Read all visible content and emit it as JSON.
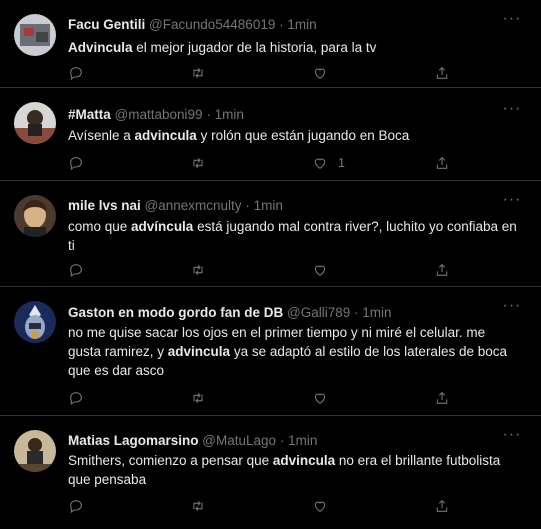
{
  "tweets": [
    {
      "name": "Facu Gentili",
      "handle": "@Facundo54486019",
      "separator": "·",
      "time": "1min",
      "text_parts": [
        {
          "bold": true,
          "text": "Advincula"
        },
        {
          "bold": false,
          "text": " el mejor jugador de la historia, para la tv"
        }
      ],
      "counts": {
        "reply": "",
        "retweet": "",
        "like": ""
      },
      "avatar_color": "#6a6f77"
    },
    {
      "name": "#Matta",
      "handle": "@mattaboni99",
      "separator": "·",
      "time": "1min",
      "text_parts": [
        {
          "bold": false,
          "text": "Avísenle a "
        },
        {
          "bold": true,
          "text": "advincula"
        },
        {
          "bold": false,
          "text": " y rolón que están jugando en Boca"
        }
      ],
      "counts": {
        "reply": "",
        "retweet": "",
        "like": "1"
      },
      "avatar_color": "#8a4a3a"
    },
    {
      "name": "mile lvs nai",
      "handle": "@annexmcnulty",
      "separator": "·",
      "time": "1min",
      "text_parts": [
        {
          "bold": false,
          "text": "como que "
        },
        {
          "bold": true,
          "text": "advíncula"
        },
        {
          "bold": false,
          "text": " está jugando mal contra river?, luchito yo confiaba en ti"
        }
      ],
      "counts": {
        "reply": "",
        "retweet": "",
        "like": ""
      },
      "avatar_color": "#7a5a40"
    },
    {
      "name": "Gaston en modo gordo fan de DB",
      "handle": "@Galli789",
      "separator": "·",
      "time": "1min",
      "text_parts": [
        {
          "bold": false,
          "text": "no me quise sacar los ojos en el primer tiempo y ni miré el celular. me gusta ramirez, y "
        },
        {
          "bold": true,
          "text": "advincula"
        },
        {
          "bold": false,
          "text": " ya se adaptó al estilo de los laterales de boca que es dar asco"
        }
      ],
      "counts": {
        "reply": "",
        "retweet": "",
        "like": ""
      },
      "avatar_color": "#3a4f9a"
    },
    {
      "name": "Matias Lagomarsino",
      "handle": "@MatuLago",
      "separator": "·",
      "time": "1min",
      "text_parts": [
        {
          "bold": false,
          "text": "Smithers, comienzo a pensar que "
        },
        {
          "bold": true,
          "text": "advincula"
        },
        {
          "bold": false,
          "text": " no era el brillante futbolista que pensaba"
        }
      ],
      "counts": {
        "reply": "",
        "retweet": "",
        "like": ""
      },
      "avatar_color": "#5a4630"
    }
  ],
  "icons": {
    "reply": "reply-icon",
    "retweet": "retweet-icon",
    "like": "like-icon",
    "share": "share-icon",
    "more": "more-icon"
  },
  "colors": {
    "background": "#000000",
    "text": "#e7e9ea",
    "secondary": "#71767b",
    "divider": "#2f3336"
  }
}
